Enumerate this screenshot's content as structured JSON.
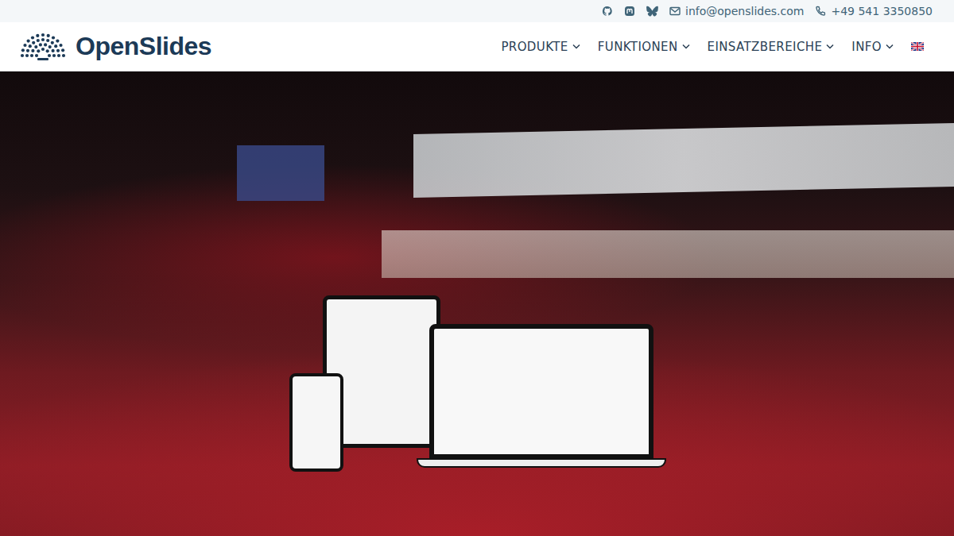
{
  "topbar": {
    "email": "info@openslides.com",
    "phone": "+49 541 3350850"
  },
  "logo": {
    "text": "OpenSlides"
  },
  "nav": {
    "items": [
      {
        "label": "PRODUKTE"
      },
      {
        "label": "FUNKTIONEN"
      },
      {
        "label": "EINSATZBEREICHE"
      },
      {
        "label": "INFO"
      }
    ]
  }
}
